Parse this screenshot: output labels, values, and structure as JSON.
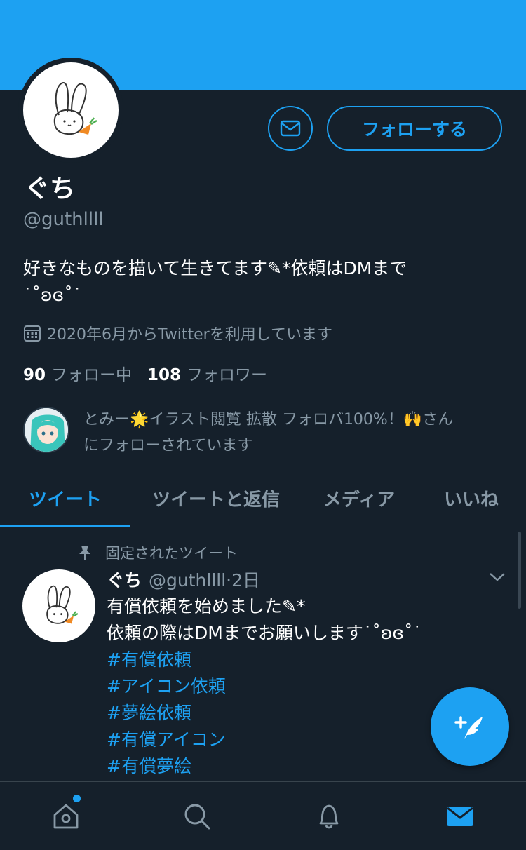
{
  "profile": {
    "name": "ぐち",
    "handle": "@guthllll",
    "bio_line1": "好きなものを描いて生きてます✎*依頼はDMまで",
    "bio_line2": "˙˚ʚɞ˚˙",
    "joined": "2020年6月からTwitterを利用しています",
    "following_count": "90",
    "following_label": "フォロー中",
    "followers_count": "108",
    "followers_label": "フォロワー",
    "follow_button": "フォローする"
  },
  "followed_by": {
    "text_line1": "とみー🌟イラスト閲覧 拡散 フォロバ100%！🙌さん",
    "text_line2": "にフォローされています"
  },
  "tabs": [
    {
      "label": "ツイート",
      "active": true
    },
    {
      "label": "ツイートと返信",
      "active": false
    },
    {
      "label": "メディア",
      "active": false
    },
    {
      "label": "いいね",
      "active": false
    }
  ],
  "pinned_tweet": {
    "pinned_label": "固定されたツイート",
    "name": "ぐち",
    "handle": "@guthllll",
    "time": "·2日",
    "line1": "有償依頼を始めました✎*",
    "line2": "依頼の際はDMまでお願いします˙˚ʚɞ˚˙",
    "hashtags": [
      "#有償依頼",
      "#アイコン依頼",
      "#夢絵依頼",
      "#有償アイコン",
      "#有償夢絵"
    ]
  },
  "icons": {
    "dm": "mail-icon",
    "calendar": "calendar-icon",
    "pin": "pin-icon",
    "chevron": "chevron-down-icon",
    "compose": "compose-tweet-icon",
    "nav": [
      "home-icon",
      "search-icon",
      "notifications-icon",
      "messages-icon"
    ]
  },
  "colors": {
    "accent": "#1da1f2",
    "background": "#15202b",
    "secondary_text": "#8899a6"
  }
}
